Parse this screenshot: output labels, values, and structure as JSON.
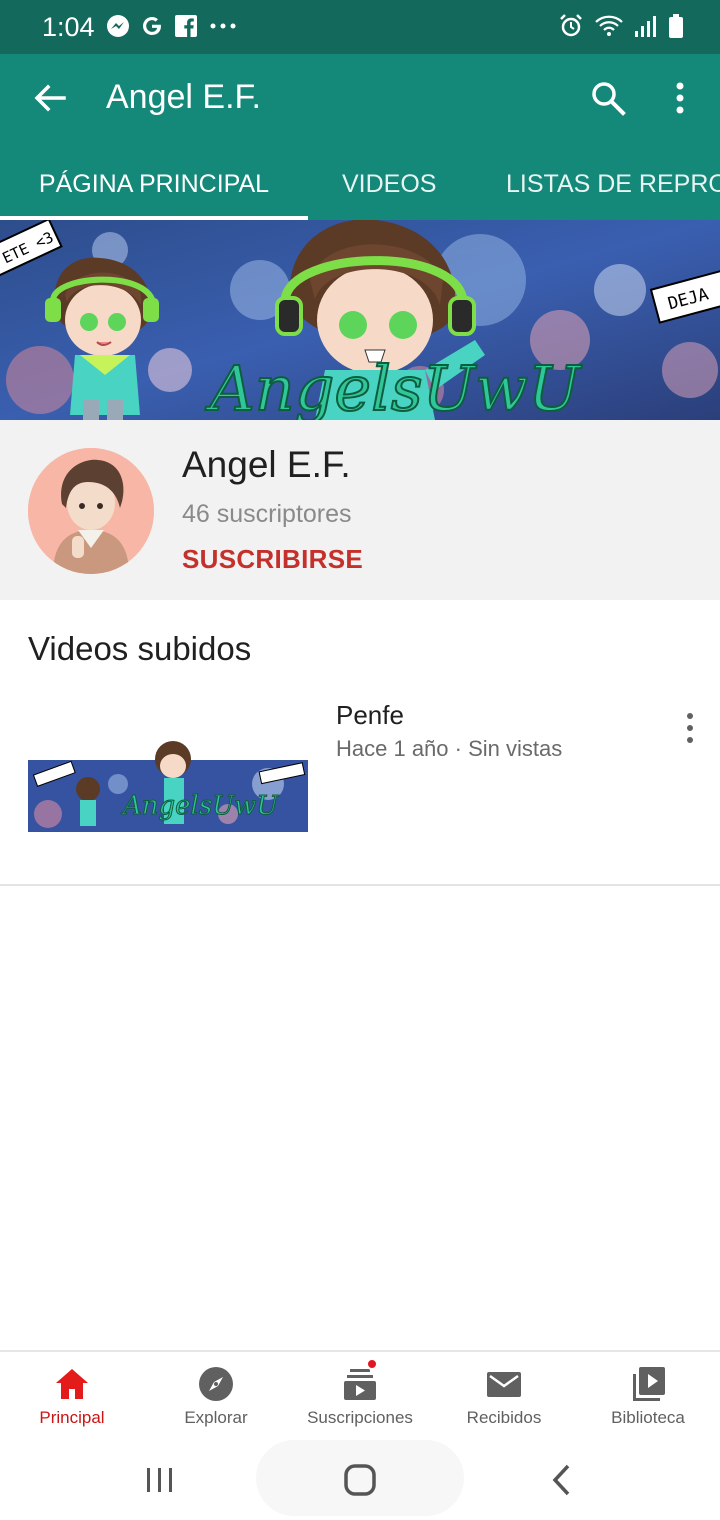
{
  "status_bar": {
    "time": "1:04",
    "notification_icons": [
      "messenger-icon",
      "google-icon",
      "facebook-icon",
      "more-notifications-icon"
    ],
    "system_icons": [
      "alarm-icon",
      "wifi-icon",
      "signal-icon",
      "battery-icon"
    ]
  },
  "app_bar": {
    "title": "Angel E.F.",
    "tabs": [
      {
        "label": "PÁGINA PRINCIPAL",
        "active": true
      },
      {
        "label": "VIDEOS",
        "active": false
      },
      {
        "label": "LISTAS DE REPRO",
        "active": false
      }
    ]
  },
  "banner": {
    "left_sign": "ETE <3",
    "right_sign": "DEJA",
    "artwork_text": "AngelsUwU"
  },
  "channel": {
    "name": "Angel E.F.",
    "subscribers": "46 suscriptores",
    "subscribe_label": "SUSCRIBIRSE"
  },
  "section": {
    "title": "Videos subidos"
  },
  "videos": [
    {
      "title": "Penfe",
      "meta": "Hace 1 año · Sin vistas"
    }
  ],
  "bottom_nav": [
    {
      "label": "Principal",
      "icon": "home-icon",
      "active": true
    },
    {
      "label": "Explorar",
      "icon": "compass-icon",
      "active": false
    },
    {
      "label": "Suscripciones",
      "icon": "subscriptions-icon",
      "active": false,
      "badge": true
    },
    {
      "label": "Recibidos",
      "icon": "mail-icon",
      "active": false
    },
    {
      "label": "Biblioteca",
      "icon": "library-icon",
      "active": false
    }
  ],
  "colors": {
    "status_bar": "#13695b",
    "app_bar": "#14897a",
    "subscribe": "#c4302b",
    "active_nav": "#cc1414"
  }
}
